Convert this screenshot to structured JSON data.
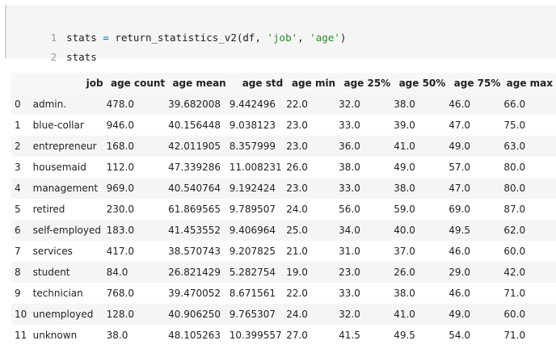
{
  "code_cell": {
    "line1": {
      "number": "1",
      "var": "stats",
      "assign": " = ",
      "func": "return_statistics_v2",
      "open": "(",
      "arg1": "df",
      "sep1": ", ",
      "arg2": "'job'",
      "sep2": ", ",
      "arg3": "'age'",
      "close": ")"
    },
    "line2": {
      "number": "2",
      "text": "stats"
    }
  },
  "table": {
    "columns": [
      "job",
      "age count",
      "age mean",
      "age std",
      "age min",
      "age 25%",
      "age 50%",
      "age 75%",
      "age max"
    ],
    "rows": [
      {
        "index": "0",
        "cells": [
          "admin.",
          "478.0",
          "39.682008",
          "9.442496",
          "22.0",
          "32.0",
          "38.0",
          "46.0",
          "66.0"
        ]
      },
      {
        "index": "1",
        "cells": [
          "blue-collar",
          "946.0",
          "40.156448",
          "9.038123",
          "23.0",
          "33.0",
          "39.0",
          "47.0",
          "75.0"
        ]
      },
      {
        "index": "2",
        "cells": [
          "entrepreneur",
          "168.0",
          "42.011905",
          "8.357999",
          "23.0",
          "36.0",
          "41.0",
          "49.0",
          "63.0"
        ]
      },
      {
        "index": "3",
        "cells": [
          "housemaid",
          "112.0",
          "47.339286",
          "11.008231",
          "26.0",
          "38.0",
          "49.0",
          "57.0",
          "80.0"
        ]
      },
      {
        "index": "4",
        "cells": [
          "management",
          "969.0",
          "40.540764",
          "9.192424",
          "23.0",
          "33.0",
          "38.0",
          "47.0",
          "80.0"
        ]
      },
      {
        "index": "5",
        "cells": [
          "retired",
          "230.0",
          "61.869565",
          "9.789507",
          "24.0",
          "56.0",
          "59.0",
          "69.0",
          "87.0"
        ]
      },
      {
        "index": "6",
        "cells": [
          "self-employed",
          "183.0",
          "41.453552",
          "9.406964",
          "25.0",
          "34.0",
          "40.0",
          "49.5",
          "62.0"
        ]
      },
      {
        "index": "7",
        "cells": [
          "services",
          "417.0",
          "38.570743",
          "9.207825",
          "21.0",
          "31.0",
          "37.0",
          "46.0",
          "60.0"
        ]
      },
      {
        "index": "8",
        "cells": [
          "student",
          "84.0",
          "26.821429",
          "5.282754",
          "19.0",
          "23.0",
          "26.0",
          "29.0",
          "42.0"
        ]
      },
      {
        "index": "9",
        "cells": [
          "technician",
          "768.0",
          "39.470052",
          "8.671561",
          "22.0",
          "33.0",
          "38.0",
          "46.0",
          "71.0"
        ]
      },
      {
        "index": "10",
        "cells": [
          "unemployed",
          "128.0",
          "40.906250",
          "9.765307",
          "24.0",
          "32.0",
          "41.0",
          "49.0",
          "60.0"
        ]
      },
      {
        "index": "11",
        "cells": [
          "unknown",
          "38.0",
          "48.105263",
          "10.399557",
          "27.0",
          "41.5",
          "49.5",
          "54.0",
          "71.0"
        ]
      }
    ]
  }
}
